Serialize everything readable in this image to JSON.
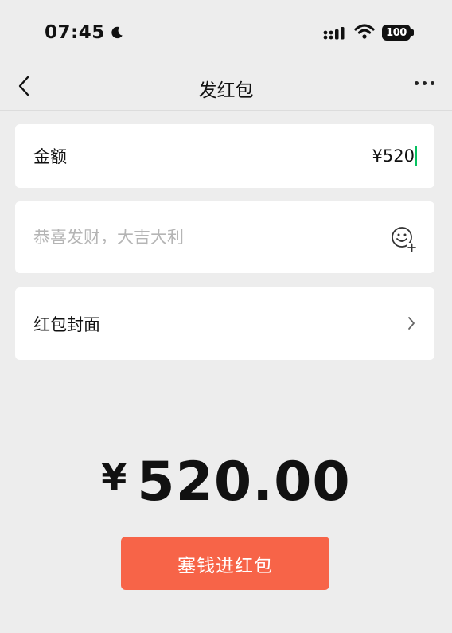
{
  "status_bar": {
    "time": "07:45",
    "battery": "100",
    "icons": [
      "moon-icon",
      "signal-icon",
      "wifi-icon",
      "battery-icon"
    ]
  },
  "nav": {
    "title": "发红包",
    "back_icon": "chevron-left-icon",
    "more_icon": "more-dots-icon"
  },
  "amount_row": {
    "label": "金额",
    "value": "¥520"
  },
  "message_row": {
    "placeholder": "恭喜发财，大吉大利",
    "value": "",
    "emoji_icon": "emoji-add-icon"
  },
  "cover_row": {
    "label": "红包封面",
    "chevron_icon": "chevron-right-icon"
  },
  "total": {
    "currency": "¥",
    "amount": "520.00"
  },
  "submit": {
    "label": "塞钱进红包"
  },
  "colors": {
    "background": "#ededed",
    "card": "#ffffff",
    "accent_button": "#f76448",
    "cursor": "#07c160",
    "placeholder": "#b5b5b5"
  }
}
